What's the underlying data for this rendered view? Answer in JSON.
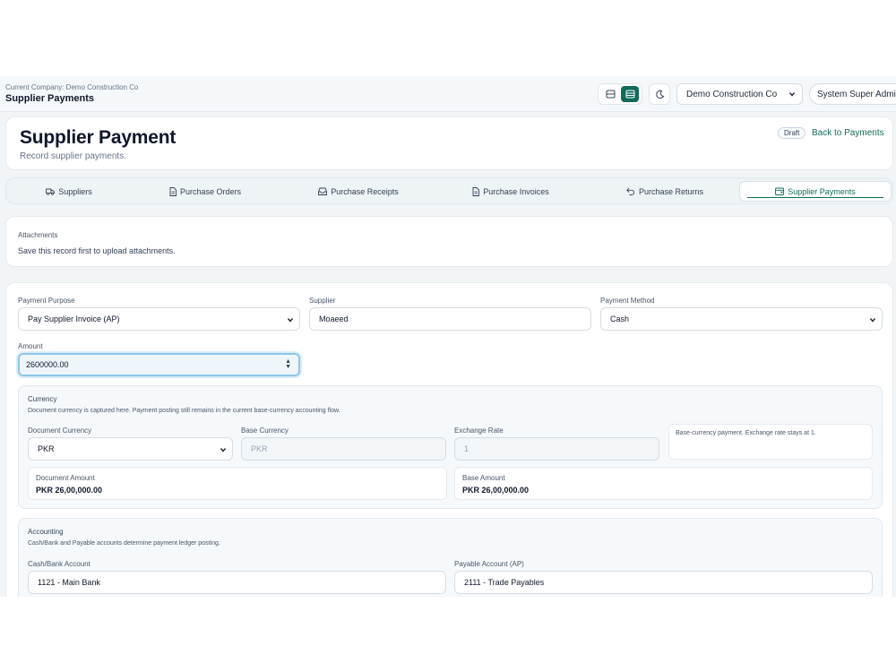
{
  "header": {
    "company_line": "Current Company: Demo Construction Co",
    "page_name": "Supplier Payments",
    "company_select": "Demo Construction Co",
    "user": "System Super Admin"
  },
  "page": {
    "title": "Supplier Payment",
    "subtitle": "Record supplier payments.",
    "status_badge": "Draft",
    "back_link": "Back to Payments"
  },
  "tabs": [
    {
      "label": "Suppliers",
      "icon": "truck-icon"
    },
    {
      "label": "Purchase Orders",
      "icon": "document-icon"
    },
    {
      "label": "Purchase Receipts",
      "icon": "inbox-icon"
    },
    {
      "label": "Purchase Invoices",
      "icon": "document-icon"
    },
    {
      "label": "Purchase Returns",
      "icon": "undo-icon"
    },
    {
      "label": "Supplier Payments",
      "icon": "wallet-icon",
      "active": true
    }
  ],
  "attachments": {
    "label": "Attachments",
    "message": "Save this record first to upload attachments."
  },
  "form": {
    "payment_purpose": {
      "label": "Payment Purpose",
      "value": "Pay Supplier Invoice (AP)"
    },
    "supplier": {
      "label": "Supplier",
      "value": "Moaeed"
    },
    "payment_method": {
      "label": "Payment Method",
      "value": "Cash"
    },
    "amount": {
      "label": "Amount",
      "value": "2600000.00"
    }
  },
  "currency": {
    "title": "Currency",
    "description": "Document currency is captured here. Payment posting still remains in the current base-currency accounting flow.",
    "document_currency": {
      "label": "Document Currency",
      "value": "PKR"
    },
    "base_currency": {
      "label": "Base Currency",
      "value": "PKR"
    },
    "exchange_rate": {
      "label": "Exchange Rate",
      "value": "1"
    },
    "note": "Base-currency payment. Exchange rate stays at 1.",
    "document_amount": {
      "label": "Document Amount",
      "value": "PKR 26,00,000.00"
    },
    "base_amount": {
      "label": "Base Amount",
      "value": "PKR 26,00,000.00"
    }
  },
  "accounting": {
    "title": "Accounting",
    "description": "Cash/Bank and Payable accounts determine payment ledger posting.",
    "cash_bank": {
      "label": "Cash/Bank Account",
      "value": "1121 - Main Bank"
    },
    "payable": {
      "label": "Payable Account (AP)",
      "value": "2111 - Trade Payables"
    }
  },
  "colors": {
    "accent": "#0f6b5a",
    "focus_border": "#8fc6e8",
    "background": "#f1f5f7"
  }
}
